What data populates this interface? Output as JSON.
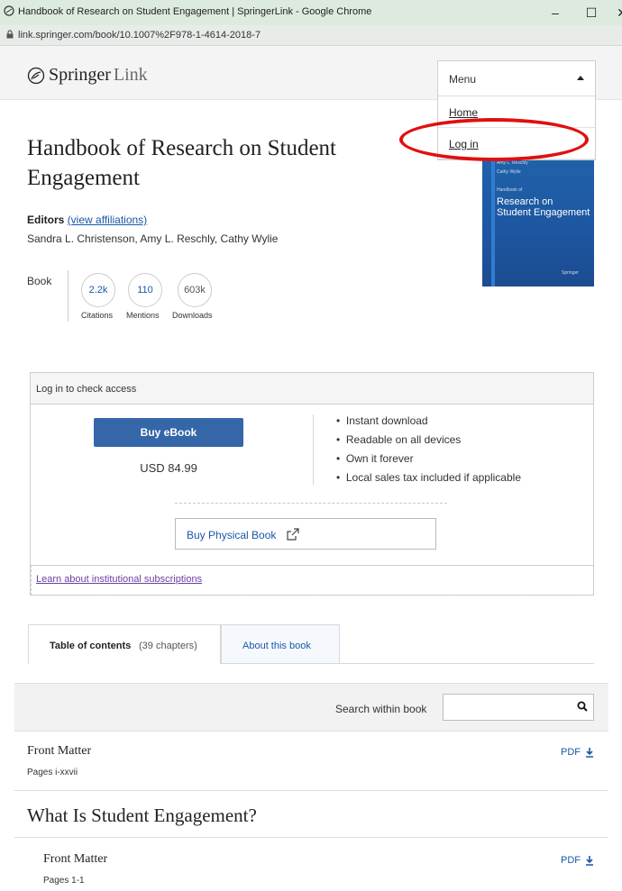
{
  "window": {
    "title": "Handbook of Research on Student Engagement | SpringerLink - Google Chrome",
    "minimize": "–",
    "maximize": "☐",
    "close": "✕",
    "url": "link.springer.com/book/10.1007%2F978-1-4614-2018-7"
  },
  "header": {
    "logo_brand": "Springer",
    "logo_suffix": "Link"
  },
  "menu": {
    "label": "Menu",
    "items": [
      "Home",
      "Log in"
    ]
  },
  "book": {
    "title": "Handbook of Research on Student Engagement",
    "editors_label": "Editors",
    "affiliations_link": "(view affiliations)",
    "editors": "Sandra L. Christenson, Amy L. Reschly, Cathy Wylie",
    "type": "Book",
    "metrics": [
      {
        "value": "2.2k",
        "label": "Citations"
      },
      {
        "value": "110",
        "label": "Mentions"
      },
      {
        "value": "603k",
        "label": "Downloads"
      }
    ],
    "cover": {
      "editors_small": "Amy L. Reschly",
      "editors_small2": "Cathy Wylie",
      "line1": "Handbook of",
      "line2": "Research on",
      "line3": "Student Engagement",
      "publisher": "Springer"
    }
  },
  "access": {
    "header": "Log in to check access",
    "buy_ebook": "Buy eBook",
    "price": "USD 84.99",
    "benefits": [
      "Instant download",
      "Readable on all devices",
      "Own it forever",
      "Local sales tax included if applicable"
    ],
    "buy_physical": "Buy Physical Book",
    "institutional": "Learn about institutional subscriptions"
  },
  "tabs": {
    "toc_label": "Table of contents",
    "toc_count": "(39 chapters)",
    "about": "About this book"
  },
  "search": {
    "label": "Search within book",
    "value": ""
  },
  "toc": {
    "front_matter_1": {
      "title": "Front Matter",
      "pages": "Pages i-xxvii",
      "pdf": "PDF"
    },
    "part_title": "What Is Student Engagement?",
    "front_matter_2": {
      "title": "Front Matter",
      "pages": "Pages 1-1",
      "pdf": "PDF"
    }
  },
  "colors": {
    "accent": "#3466a8",
    "link": "#1a57a8",
    "highlight_ring": "#e01010"
  }
}
